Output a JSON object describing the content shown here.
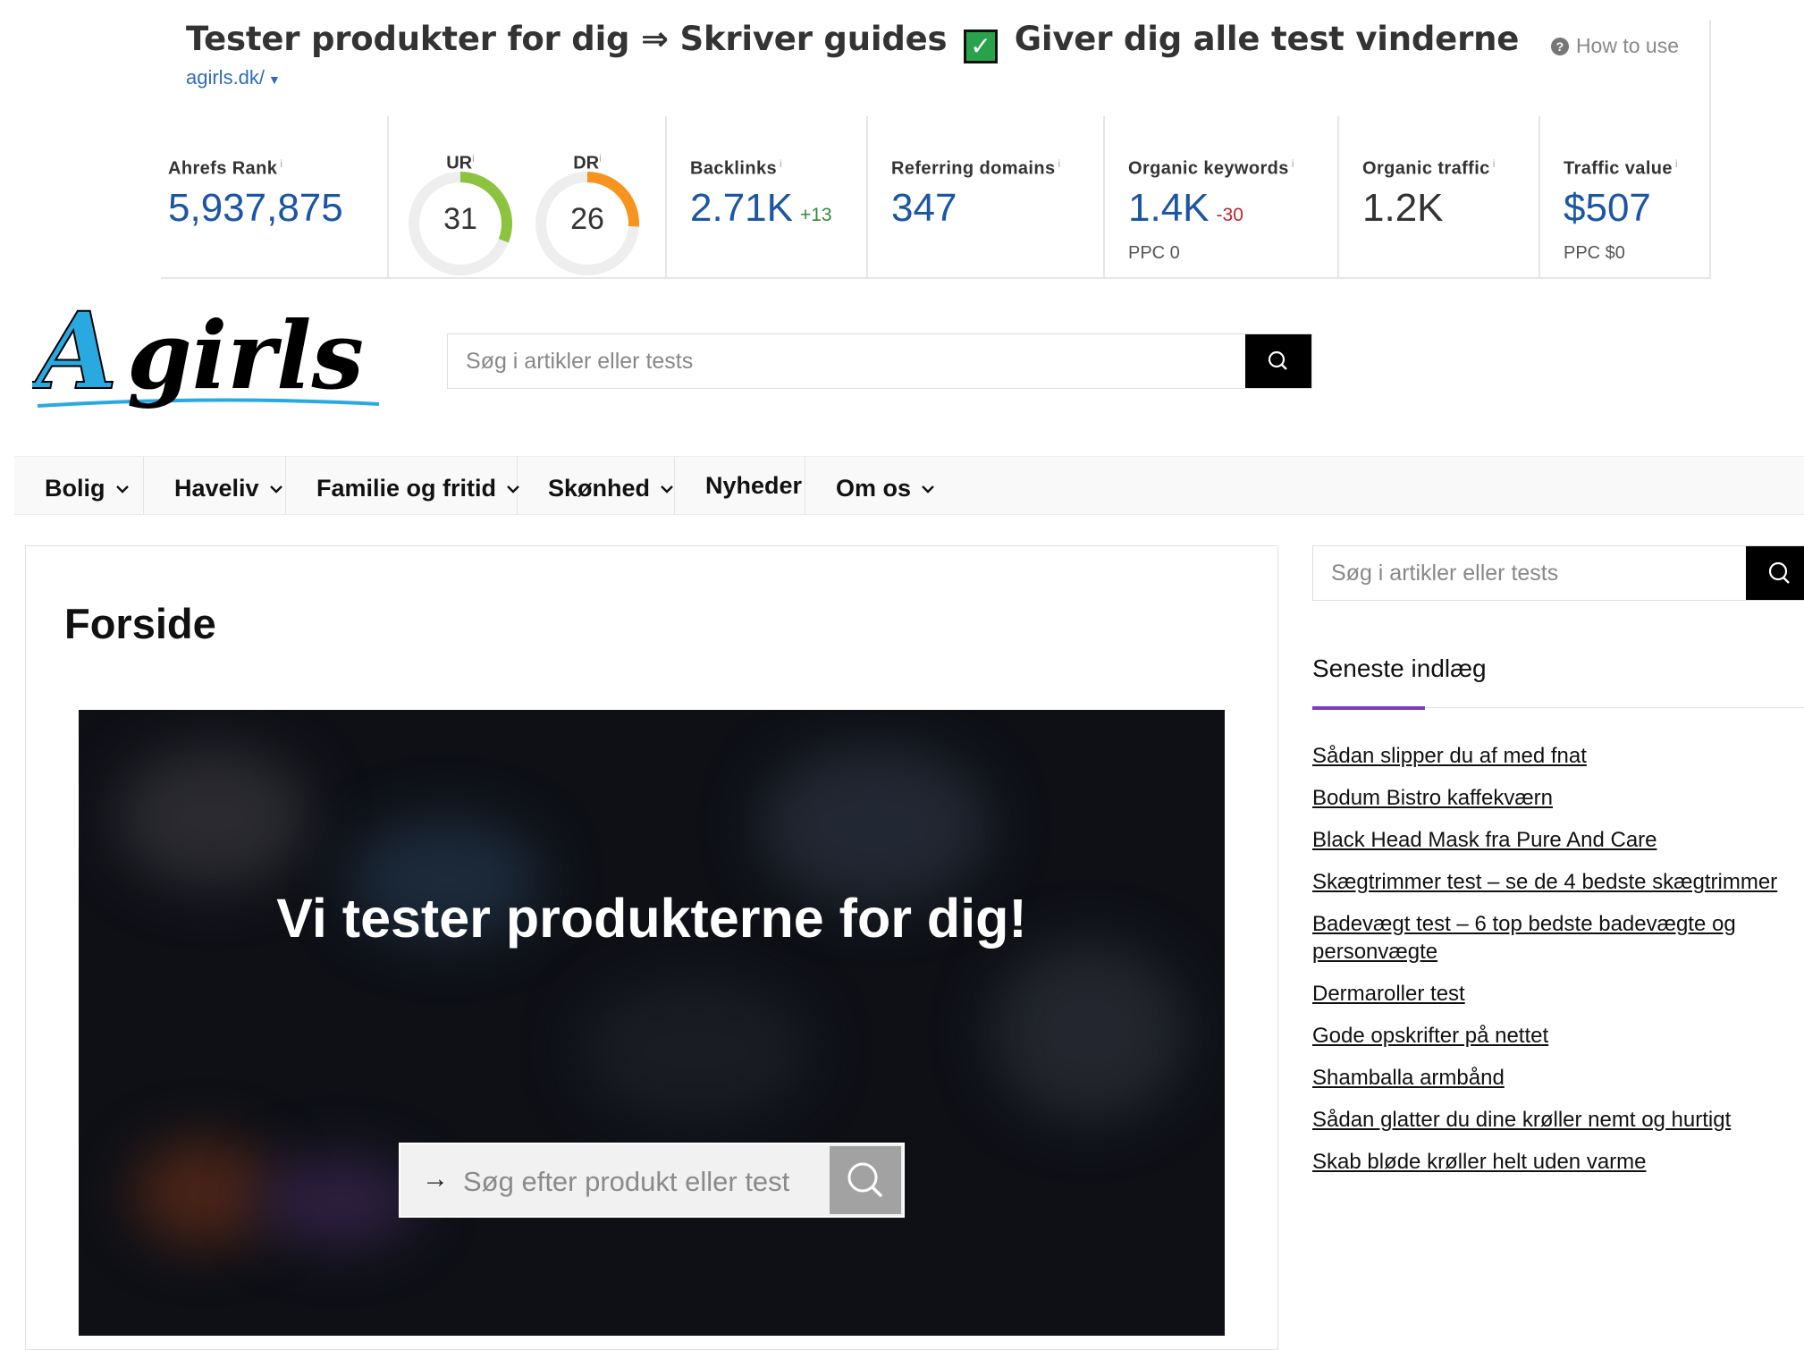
{
  "ahrefs": {
    "title_part1": "Tester produkter for dig ⇒ Skriver guides",
    "title_check": "✓",
    "title_part2": "Giver dig alle test vinderne",
    "url": "agirls.dk/",
    "how_to_use": "How to use",
    "info_mark": "i",
    "metrics": {
      "ahrefs_rank": {
        "label": "Ahrefs Rank",
        "value": "5,937,875"
      },
      "ur": {
        "label": "UR",
        "value": "31",
        "score": 31
      },
      "dr": {
        "label": "DR",
        "value": "26",
        "score": 26
      },
      "backlinks": {
        "label": "Backlinks",
        "value": "2.71K",
        "delta": "+13"
      },
      "referring_domains": {
        "label": "Referring domains",
        "value": "347"
      },
      "organic_keywords": {
        "label": "Organic keywords",
        "value": "1.4K",
        "delta": "-30",
        "sub": "PPC 0"
      },
      "organic_traffic": {
        "label": "Organic traffic",
        "value": "1.2K"
      },
      "traffic_value": {
        "label": "Traffic value",
        "value": "$507",
        "sub": "PPC $0"
      }
    }
  },
  "site": {
    "logo_text": "Agirls",
    "search_placeholder": "Søg i artikler eller tests",
    "nav": [
      {
        "label": "Bolig",
        "dropdown": true
      },
      {
        "label": "Haveliv",
        "dropdown": true
      },
      {
        "label": "Familie og fritid",
        "dropdown": true
      },
      {
        "label": "Skønhed",
        "dropdown": true
      },
      {
        "label": "Nyheder",
        "dropdown": false
      },
      {
        "label": "Om os",
        "dropdown": true
      }
    ],
    "page_title": "Forside",
    "hero": {
      "heading": "Vi tester produkterne for dig!",
      "search_placeholder": "Søg efter produkt eller test"
    },
    "sidebar": {
      "search_placeholder": "Søg i artikler eller tests",
      "heading": "Seneste indlæg",
      "posts": [
        "Sådan slipper du af med fnat",
        "Bodum Bistro kaffekværn",
        "Black Head Mask fra Pure And Care",
        "Skægtrimmer test – se de 4 bedste skægtrimmer",
        "Badevægt test – 6 top bedste badevægte og personvægte",
        "Dermaroller test",
        "Gode opskrifter på nettet",
        "Shamballa armbånd",
        "Sådan glatter du dine krøller nemt og hurtigt",
        "Skab bløde krøller helt uden varme"
      ]
    }
  },
  "colors": {
    "ahrefs_blue": "#1c56a3",
    "ur_gauge": "#8cc43f",
    "dr_gauge": "#f7941d",
    "delta_up": "#2f8a3a",
    "delta_down": "#c0262c",
    "accent": "#7e3bbd",
    "logo_blue": "#2aa9e0"
  }
}
